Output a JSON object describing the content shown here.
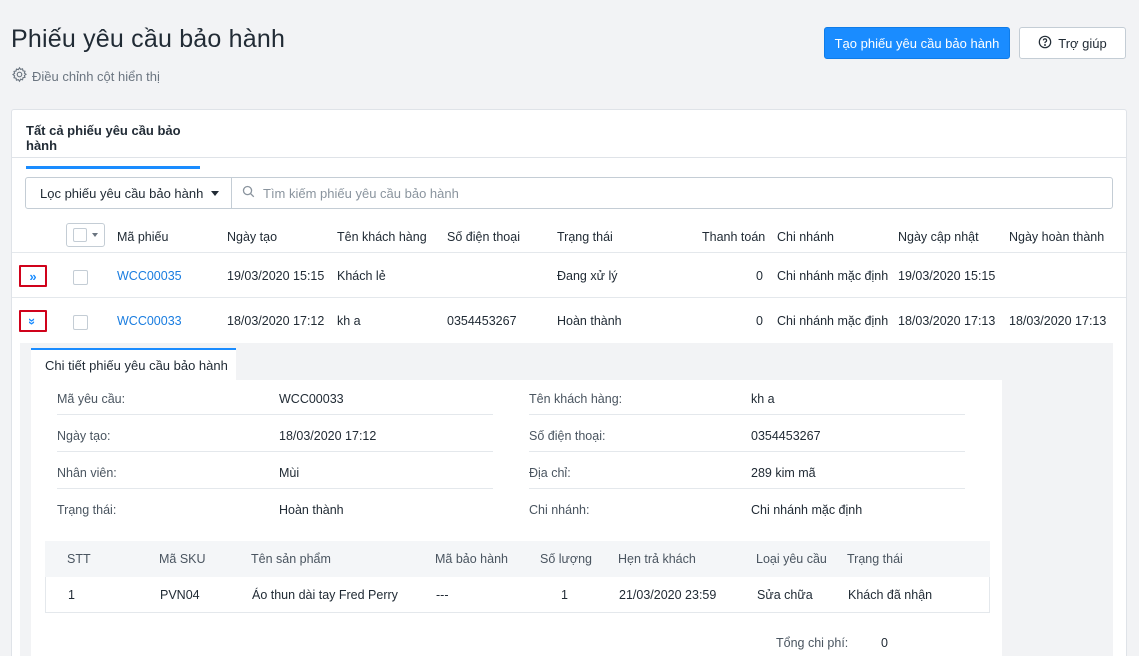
{
  "header": {
    "title": "Phiếu yêu cầu bảo hành",
    "adjust_columns": "Điều chỉnh cột hiển thị",
    "create_button": "Tạo phiếu yêu cầu bảo hành",
    "help_button": "Trợ giúp"
  },
  "tabs": {
    "all": "Tất cả phiếu yêu cầu bảo hành"
  },
  "filter": {
    "label": "Lọc phiếu yêu cầu bảo hành",
    "search_placeholder": "Tìm kiếm phiếu yêu cầu bảo hành"
  },
  "table": {
    "columns": [
      "Mã phiếu",
      "Ngày tạo",
      "Tên khách hàng",
      "Số điện thoại",
      "Trạng thái",
      "Thanh toán",
      "Chi nhánh",
      "Ngày cập nhật",
      "Ngày hoàn thành"
    ],
    "rows": [
      {
        "toggle": "»",
        "code": "WCC00035",
        "created": "19/03/2020 15:15",
        "customer": "Khách lẻ",
        "phone": "",
        "status": "Đang xử lý",
        "payment": "0",
        "branch": "Chi nhánh mặc định",
        "updated": "19/03/2020 15:15",
        "completed": ""
      },
      {
        "toggle": "»",
        "code": "WCC00033",
        "created": "18/03/2020 17:12",
        "customer": "kh a",
        "phone": "0354453267",
        "status": "Hoàn thành",
        "payment": "0",
        "branch": "Chi nhánh mặc định",
        "updated": "18/03/2020 17:13",
        "completed": "18/03/2020 17:13"
      }
    ]
  },
  "detail": {
    "tab": "Chi tiết phiếu yêu cầu bảo hành",
    "fields": {
      "code_label": "Mã yêu cầu:",
      "code_value": "WCC00033",
      "created_label": "Ngày tạo:",
      "created_value": "18/03/2020 17:12",
      "staff_label": "Nhân viên:",
      "staff_value": "Mùi",
      "status_label": "Trạng thái:",
      "status_value": "Hoàn thành",
      "customer_label": "Tên khách hàng:",
      "customer_value": "kh a",
      "phone_label": "Số điện thoại:",
      "phone_value": "0354453267",
      "address_label": "Địa chỉ:",
      "address_value": "289 kim mã",
      "branch_label": "Chi nhánh:",
      "branch_value": "Chi nhánh mặc định"
    },
    "items": {
      "columns": [
        "STT",
        "Mã SKU",
        "Tên sản phẩm",
        "Mã bảo hành",
        "Số lượng",
        "Hẹn trả khách",
        "Loại yêu cầu",
        "Trạng thái"
      ],
      "rows": [
        {
          "stt": "1",
          "sku": "PVN04",
          "product": "Áo thun dài tay Fred Perry",
          "warranty_code": "---",
          "qty": "1",
          "return_date": "21/03/2020 23:59",
          "request_type": "Sửa chữa",
          "status": "Khách đã nhận"
        }
      ]
    },
    "total_label": "Tổng chi phí:",
    "total_value": "0"
  },
  "colors": {
    "primary": "#1a8cff",
    "link": "#1a7de0",
    "highlight_border": "#d0021b"
  }
}
